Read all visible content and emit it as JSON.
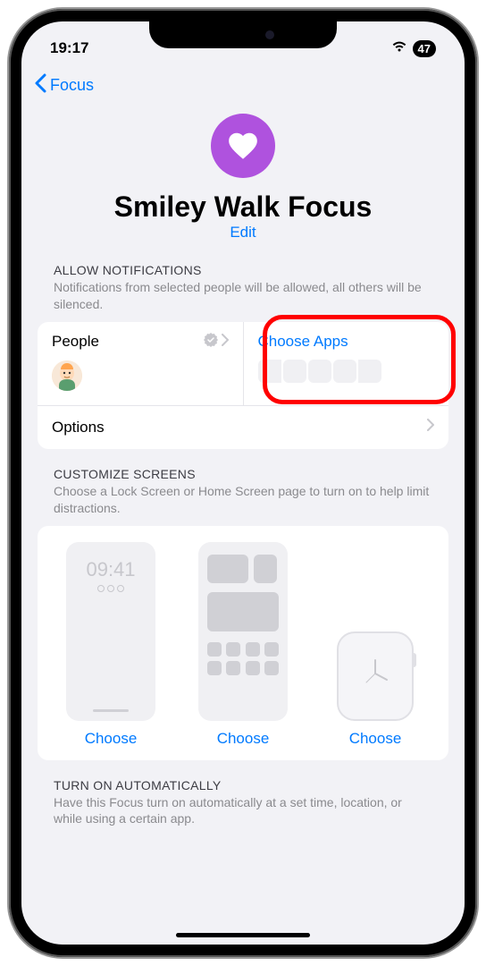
{
  "statusBar": {
    "time": "19:17",
    "battery": "47"
  },
  "nav": {
    "backLabel": "Focus"
  },
  "header": {
    "title": "Smiley Walk Focus",
    "editLabel": "Edit"
  },
  "notifications": {
    "heading": "ALLOW NOTIFICATIONS",
    "subtitle": "Notifications from selected people will be allowed, all others will be silenced.",
    "peopleLabel": "People",
    "chooseAppsLabel": "Choose Apps",
    "optionsLabel": "Options"
  },
  "customize": {
    "heading": "CUSTOMIZE SCREENS",
    "subtitle": "Choose a Lock Screen or Home Screen page to turn on to help limit distractions.",
    "lockTime": "09:41",
    "chooseLabel": "Choose"
  },
  "automatic": {
    "heading": "TURN ON AUTOMATICALLY",
    "subtitle": "Have this Focus turn on automatically at a set time, location, or while using a certain app."
  }
}
